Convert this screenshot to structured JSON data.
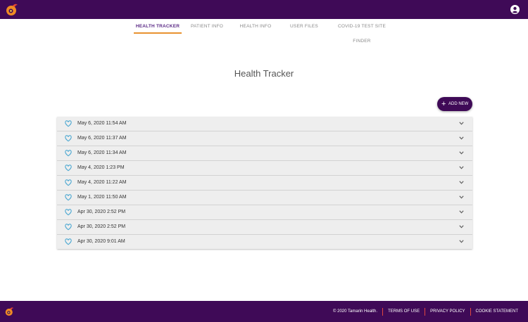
{
  "nav": {
    "tabs": [
      {
        "label": "HEALTH TRACKER"
      },
      {
        "label": "PATIENT INFO"
      },
      {
        "label": "HEALTH INFO"
      },
      {
        "label": "USER FILES"
      },
      {
        "label": "COVID-19 TEST SITE FINDER"
      }
    ],
    "active_tab": "HEALTH TRACKER"
  },
  "main": {
    "title": "Health Tracker",
    "add_button_label": "ADD NEW",
    "entries": [
      {
        "date": "May 6, 2020 11:54 AM"
      },
      {
        "date": "May 6, 2020 11:37 AM"
      },
      {
        "date": "May 6, 2020 11:34 AM"
      },
      {
        "date": "May 4, 2020 1:23 PM"
      },
      {
        "date": "May 4, 2020 11:22 AM"
      },
      {
        "date": "May 1, 2020 11:50 AM"
      },
      {
        "date": "Apr 30, 2020 2:52 PM"
      },
      {
        "date": "Apr 30, 2020 2:52 PM"
      },
      {
        "date": "Apr 30, 2020 9:01 AM"
      }
    ]
  },
  "footer": {
    "copyright": "© 2020 Tamarin Health.",
    "links": [
      "TERMS OF USE",
      "PRIVACY POLICY",
      "COOKIE STATEMENT"
    ]
  },
  "colors": {
    "brand_purple": "#3f0a57",
    "tab_active_text": "#5b2a86",
    "tab_underline": "#e8922f",
    "heart_icon": "#4aa7d1",
    "row_background": "#eeeeee",
    "footer_divider": "#e0463f"
  },
  "icons": {
    "header_logo": "tamarin-logo-icon",
    "account": "account-circle-icon",
    "entry": "heart-outline-icon",
    "expand": "chevron-down-icon",
    "add": "plus-icon"
  }
}
